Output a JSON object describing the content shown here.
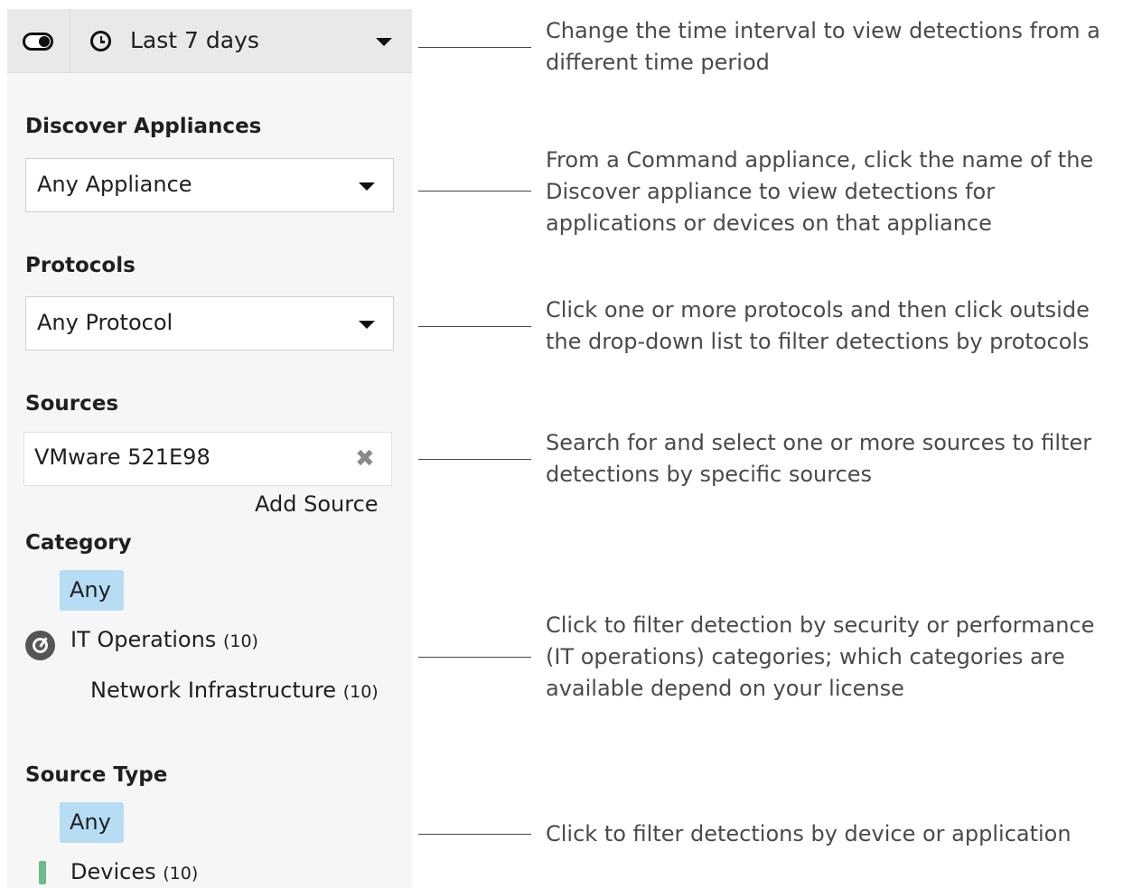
{
  "time_filter": {
    "label": "Last 7 days"
  },
  "discover": {
    "heading": "Discover Appliances",
    "value": "Any Appliance"
  },
  "protocols": {
    "heading": "Protocols",
    "value": "Any Protocol"
  },
  "sources": {
    "heading": "Sources",
    "selected": "VMware 521E98",
    "add_label": "Add Source"
  },
  "category": {
    "heading": "Category",
    "any_label": "Any",
    "items": [
      {
        "label": "IT Operations",
        "count": "(10)"
      },
      {
        "label": "Network Infrastructure",
        "count": "(10)"
      }
    ]
  },
  "source_type": {
    "heading": "Source Type",
    "any_label": "Any",
    "items": [
      {
        "label": "Devices",
        "count": "(10)"
      }
    ]
  },
  "annotations": [
    "Change the time interval to view detections from a different time period",
    "From a Command appliance, click the name of the Discover appliance to view detections for applications or devices on that appliance",
    "Click one or more protocols and then click outside the drop-down list to filter detections by protocols",
    "Search for and select one or more sources to filter detections by specific sources",
    "Click to filter detection by security or performance (IT operations) categories; which categories are available depend on your license",
    "Click to filter detections by device or application"
  ],
  "colors": {
    "any_pill": "#b6ddf4",
    "device_marker": "#6db98a",
    "panel_bg": "#f6f6f6"
  },
  "icons": {
    "toggle": "toggle-icon",
    "clock": "clock-icon",
    "clear": "clear-icon",
    "gauge": "gauge-icon",
    "device": "device-bar-icon"
  }
}
